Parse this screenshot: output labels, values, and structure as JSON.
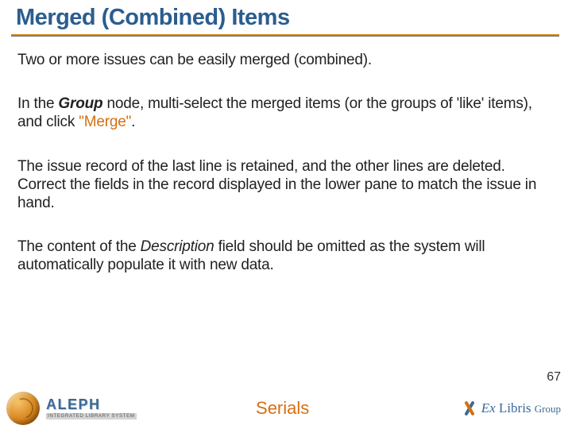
{
  "title": "Merged (Combined) Items",
  "para1": "Two or more issues can be easily merged (combined).",
  "para2_a": "In the ",
  "para2_group": "Group",
  "para2_b": " node, multi-select the merged items (or the groups of 'like' items), and click ",
  "para2_merge": "\"Merge\"",
  "para2_c": ".",
  "para3": "The issue record of the last line is retained, and the other lines are deleted. Correct the fields in the record displayed in the lower pane to match the issue in hand.",
  "para4_a": "The content of the ",
  "para4_desc": "Description",
  "para4_b": " field should be omitted as the system will automatically populate it with new data.",
  "page_number": "67",
  "footer": {
    "aleph": "ALEPH",
    "aleph_sub": "INTEGRATED LIBRARY SYSTEM",
    "center": "Serials",
    "exlibris_ex": "Ex",
    "exlibris_libris": " Libris ",
    "exlibris_group": "Group"
  }
}
